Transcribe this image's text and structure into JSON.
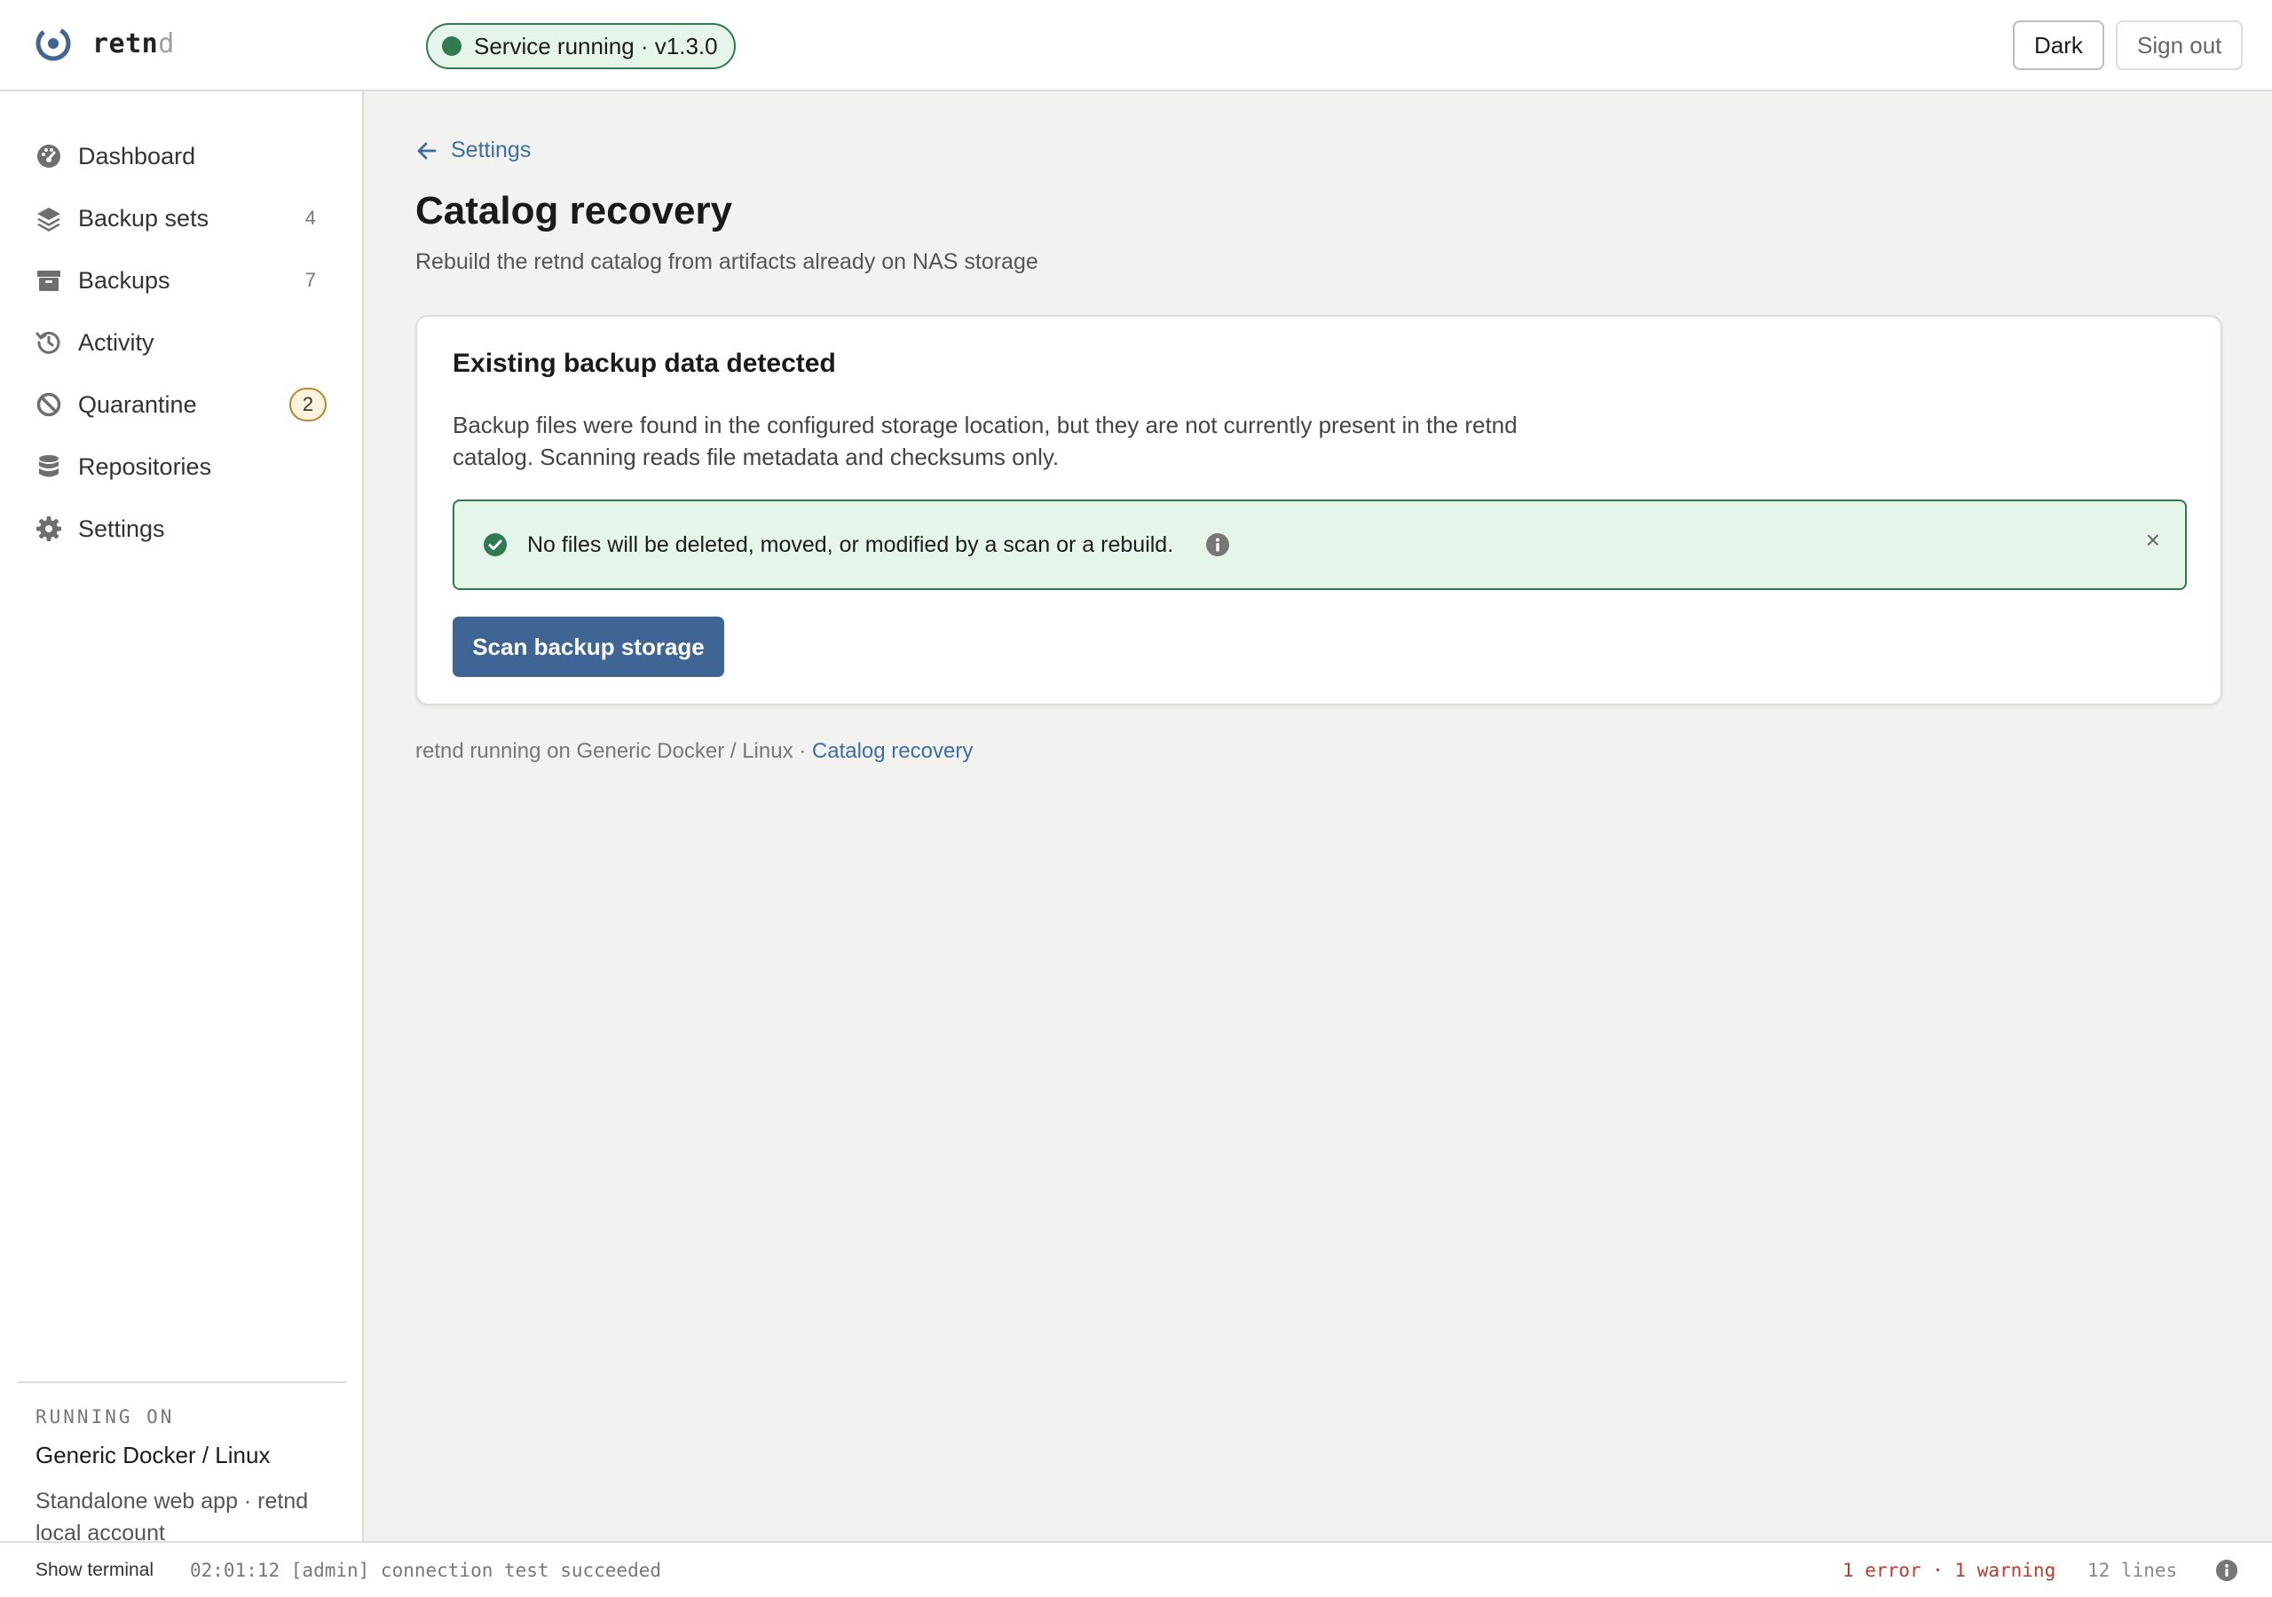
{
  "app": {
    "brand_main": "retn",
    "brand_faded": "d",
    "status": "Service running · v1.3.0"
  },
  "header": {
    "theme_label": "Dark",
    "signout_label": "Sign out"
  },
  "sidebar": {
    "items": [
      {
        "label": "Dashboard",
        "icon": "gauge-icon"
      },
      {
        "label": "Backup sets",
        "icon": "layers-icon",
        "count": "4"
      },
      {
        "label": "Backups",
        "icon": "archive-box-icon",
        "count": "7"
      },
      {
        "label": "Activity",
        "icon": "history-icon"
      },
      {
        "label": "Quarantine",
        "icon": "ban-icon",
        "badge": "2"
      },
      {
        "label": "Repositories",
        "icon": "database-icon"
      },
      {
        "label": "Settings",
        "icon": "gear-icon"
      }
    ],
    "footer": {
      "label": "RUNNING ON",
      "platform": "Generic Docker / Linux",
      "description": "Standalone web app · retnd local account"
    }
  },
  "main": {
    "back_label": "Settings",
    "title": "Catalog recovery",
    "subtitle": "Rebuild the retnd catalog from artifacts already on NAS storage",
    "card": {
      "title": "Existing backup data detected",
      "description": "Backup files were found in the configured storage location, but they are not currently present in the retnd catalog. Scanning reads file metadata and checksums only.",
      "alert_text": "No files will be deleted, moved, or modified by a scan or a rebuild.",
      "alert_close": "×",
      "action_label": "Scan backup storage"
    },
    "footer_prefix": "retnd running on Generic Docker / Linux ·",
    "footer_link": "Catalog recovery"
  },
  "terminal": {
    "toggle_label": "Show terminal",
    "last_line": "02:01:12 [admin] connection test succeeded",
    "summary": "1 error · 1 warning",
    "line_count": "12 lines"
  },
  "colors": {
    "accent": "#3f6594",
    "link": "#3a6ea5",
    "success": "#2f7a4f",
    "success_bg": "#e6f5ea",
    "warning": "#b8892c",
    "error": "#c0392b"
  }
}
